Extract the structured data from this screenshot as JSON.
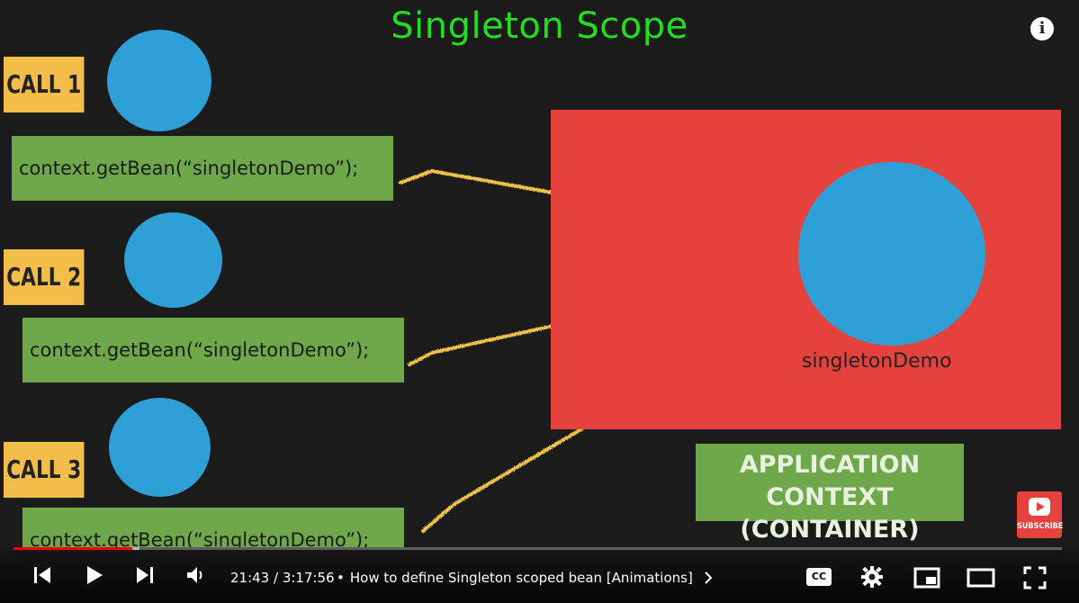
{
  "video": {
    "title": "Singleton Scope",
    "calls": [
      {
        "label": "CALL 1",
        "code": "context.getBean(“singletonDemo”);"
      },
      {
        "label": "CALL 2",
        "code": "context.getBean(“singletonDemo”);"
      },
      {
        "label": "CALL 3",
        "code": "context.getBean(“singletonDemo”);"
      }
    ],
    "bean_label": "singletonDemo",
    "app_context_line1": "APPLICATION CONTEXT",
    "app_context_line2": "(CONTAINER)",
    "subscribe_label": "SUBSCRIBE",
    "colors": {
      "title": "#22dd22",
      "call": "#f3bd4a",
      "code": "#6ea84a",
      "bean": "#2f9fd8",
      "container": "#e5423e",
      "arrow": "#f2c14a"
    }
  },
  "player": {
    "info_icon": "i",
    "progress_fraction": 0.113,
    "time_current": "21:43",
    "time_total": "3:17:56",
    "time_display": "21:43 / 3:17:56",
    "chapter_sep": "•",
    "chapter_title": "How to define Singleton scoped bean [Animations]",
    "icons": [
      "previous-icon",
      "play-icon",
      "next-icon",
      "volume-icon",
      "chevron-right-icon",
      "captions-icon",
      "settings-icon",
      "miniplayer-icon",
      "theater-icon",
      "fullscreen-icon"
    ],
    "captions_label": "CC"
  }
}
